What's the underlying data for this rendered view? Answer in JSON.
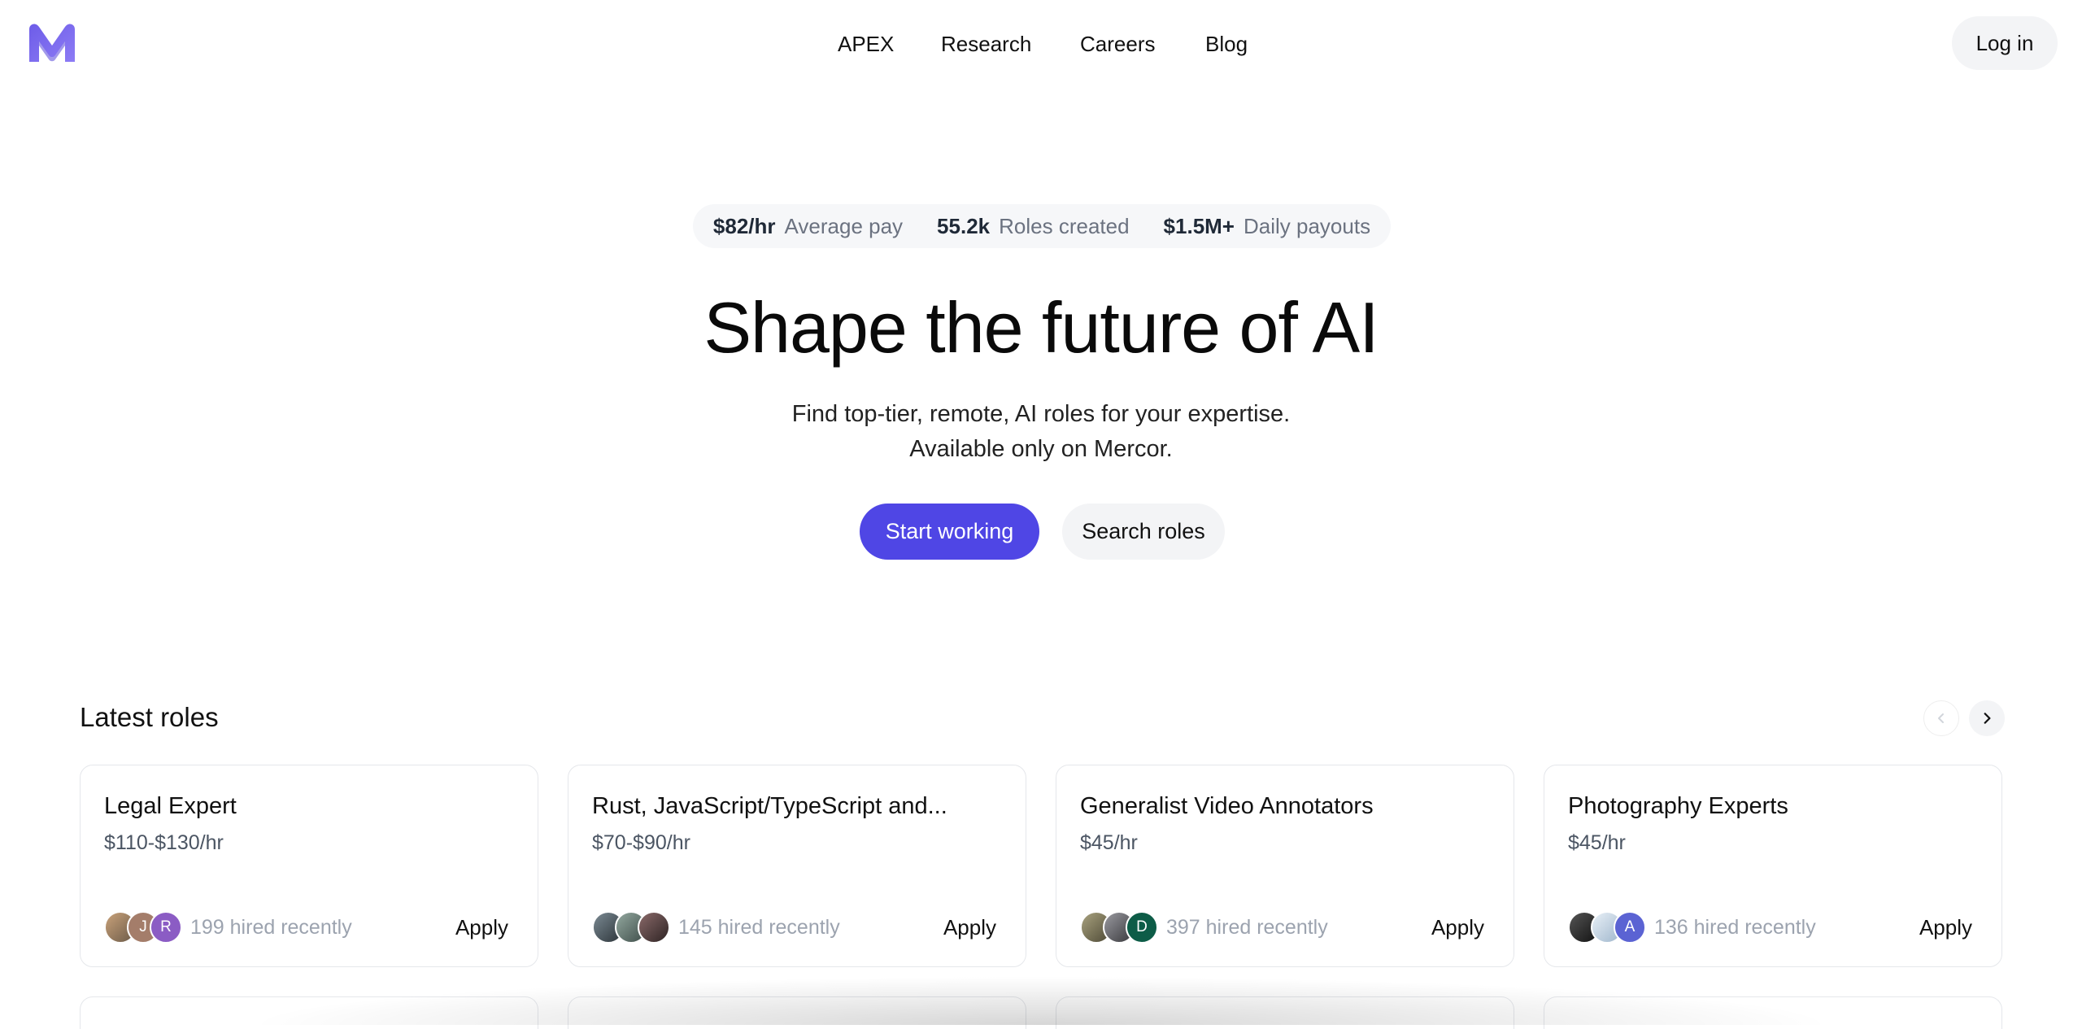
{
  "brand": {
    "logo_icon": "mercor-m-logo",
    "accent": "#4f46e5"
  },
  "nav": {
    "links": [
      "APEX",
      "Research",
      "Careers",
      "Blog"
    ],
    "login_label": "Log in"
  },
  "stats": [
    {
      "value": "$82/hr",
      "label": "Average pay"
    },
    {
      "value": "55.2k",
      "label": "Roles created"
    },
    {
      "value": "$1.5M+",
      "label": "Daily payouts"
    }
  ],
  "hero": {
    "title": "Shape the future of AI",
    "subtitle_line1": "Find top-tier, remote, AI roles for your expertise.",
    "subtitle_line2": "Available only on Mercor.",
    "primary_cta": "Start working",
    "secondary_cta": "Search roles"
  },
  "latest_roles": {
    "title": "Latest roles",
    "prev_icon": "chevron-left-icon",
    "next_icon": "chevron-right-icon",
    "apply_label": "Apply",
    "cards": [
      {
        "title": "Legal Expert",
        "pay": "$110-$130/hr",
        "hired": "199 hired recently",
        "avatars": [
          {
            "kind": "photo",
            "color": "#9a7a5a",
            "letter": ""
          },
          {
            "kind": "letter",
            "color": "#a47d6a",
            "letter": "J"
          },
          {
            "kind": "letter",
            "color": "#8b5cc4",
            "letter": "R"
          }
        ]
      },
      {
        "title": "Rust, JavaScript/TypeScript and...",
        "pay": "$70-$90/hr",
        "hired": "145 hired recently",
        "avatars": [
          {
            "kind": "photo",
            "color": "#3e4a52",
            "letter": ""
          },
          {
            "kind": "photo",
            "color": "#5c6f6a",
            "letter": ""
          },
          {
            "kind": "photo",
            "color": "#4a3a3a",
            "letter": ""
          }
        ]
      },
      {
        "title": "Generalist Video Annotators",
        "pay": "$45/hr",
        "hired": "397 hired recently",
        "avatars": [
          {
            "kind": "photo",
            "color": "#6f6a52",
            "letter": ""
          },
          {
            "kind": "photo",
            "color": "#5a5a5e",
            "letter": ""
          },
          {
            "kind": "letter",
            "color": "#0d5c47",
            "letter": "D"
          }
        ]
      },
      {
        "title": "Photography Experts",
        "pay": "$45/hr",
        "hired": "136 hired recently",
        "avatars": [
          {
            "kind": "photo",
            "color": "#2a2a2a",
            "letter": ""
          },
          {
            "kind": "photo",
            "color": "#c7d7e6",
            "letter": ""
          },
          {
            "kind": "letter",
            "color": "#5b63d3",
            "letter": "A"
          }
        ]
      }
    ]
  }
}
